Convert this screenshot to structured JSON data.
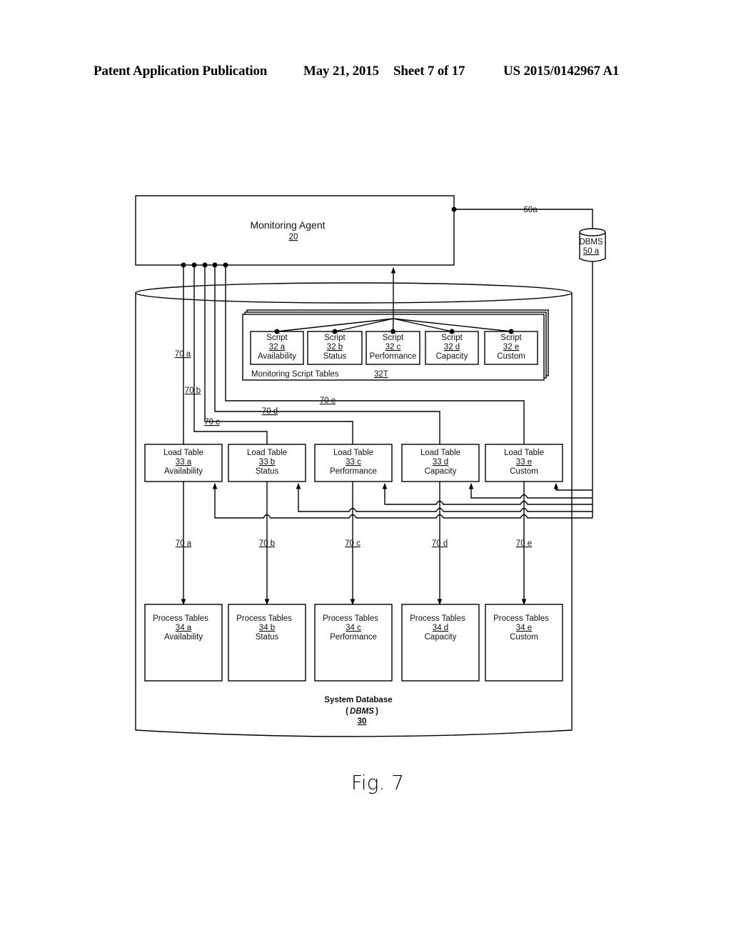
{
  "header": {
    "publication": "Patent Application Publication",
    "date": "May 21, 2015",
    "sheet": "Sheet 7 of 17",
    "patent_number": "US 2015/0142967 A1"
  },
  "monitoring_agent": {
    "title": "Monitoring Agent",
    "ref": "20"
  },
  "dbms_side": {
    "title": "DBMS",
    "ref": "50 a",
    "link_ref": "60a"
  },
  "script_tables": {
    "title": "Monitoring Script Tables",
    "ref": "32T",
    "scripts": [
      {
        "title": "Script",
        "ref": "32 a",
        "kind": "Availability"
      },
      {
        "title": "Script",
        "ref": "32 b",
        "kind": "Status"
      },
      {
        "title": "Script",
        "ref": "32 c",
        "kind": "Performance"
      },
      {
        "title": "Script",
        "ref": "32 d",
        "kind": "Capacity"
      },
      {
        "title": "Script",
        "ref": "32 e",
        "kind": "Custom"
      }
    ]
  },
  "connectors": [
    "70 a",
    "70 b",
    "70 c",
    "70 d",
    "70 e"
  ],
  "load_tables": [
    {
      "title": "Load Table",
      "ref": "33 a",
      "kind": "Availability"
    },
    {
      "title": "Load Table",
      "ref": "33 b",
      "kind": "Status"
    },
    {
      "title": "Load Table",
      "ref": "33 c",
      "kind": "Performance"
    },
    {
      "title": "Load Table",
      "ref": "33 d",
      "kind": "Capacity"
    },
    {
      "title": "Load Table",
      "ref": "33 e",
      "kind": "Custom"
    }
  ],
  "process_tables": [
    {
      "title": "Process Tables",
      "ref": "34 a",
      "kind": "Availability"
    },
    {
      "title": "Process Tables",
      "ref": "34 b",
      "kind": "Status"
    },
    {
      "title": "Process Tables",
      "ref": "34 c",
      "kind": "Performance"
    },
    {
      "title": "Process Tables",
      "ref": "34 d",
      "kind": "Capacity"
    },
    {
      "title": "Process Tables",
      "ref": "34 e",
      "kind": "Custom"
    }
  ],
  "system_database": {
    "title": "System Database",
    "subtitle_open": "(",
    "subtitle": "DBMS",
    "subtitle_close": ")",
    "ref": "30"
  },
  "figure_caption": "Fig. 7"
}
